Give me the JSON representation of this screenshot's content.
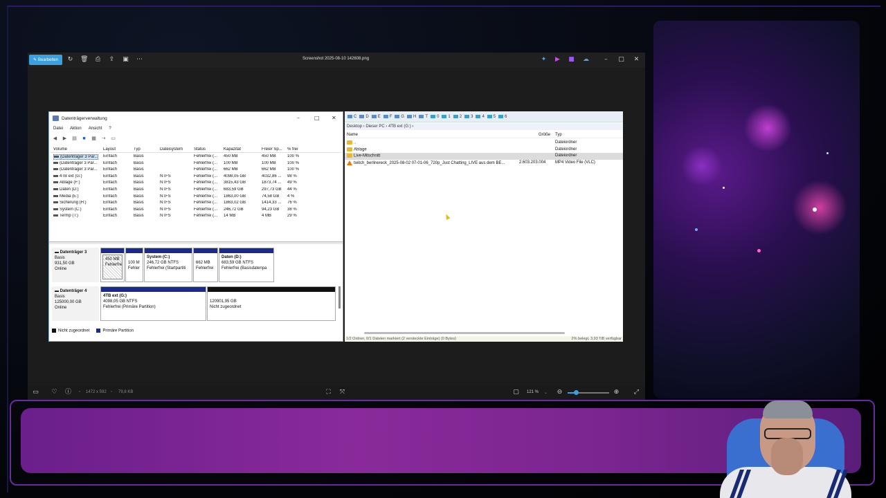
{
  "viewer": {
    "edit_label": "Bearbeiten",
    "title": "Screenshot 2025-08-10 142608.png",
    "dimensions": "1472 x 592",
    "filesize": "79,8 KB",
    "zoom": "121 %",
    "zoom_fraction": 0.2,
    "accent_color": "#3aa0e0"
  },
  "disk_mgmt": {
    "title": "Datenträgerverwaltung",
    "menu": [
      "Datei",
      "Aktion",
      "Ansicht",
      "?"
    ],
    "columns": [
      "Volume",
      "Layout",
      "Typ",
      "Dateisystem",
      "Status",
      "Kapazität",
      "Freier Sp...",
      "% frei"
    ],
    "rows": [
      [
        "(Datenträger 3 Par...",
        "Einfach",
        "Basis",
        "",
        "Fehlerfrei (...",
        "450 MB",
        "450 MB",
        "100 %"
      ],
      [
        "(Datenträger 3 Par...",
        "Einfach",
        "Basis",
        "",
        "Fehlerfrei (...",
        "100 MB",
        "100 MB",
        "100 %"
      ],
      [
        "(Datenträger 3 Par...",
        "Einfach",
        "Basis",
        "",
        "Fehlerfrei (...",
        "662 MB",
        "662 MB",
        "100 %"
      ],
      [
        "4TB ext (G:)",
        "Einfach",
        "Basis",
        "NTFS",
        "Fehlerfrei (...",
        "4098,05 GB",
        "4032,86 ...",
        "98 %"
      ],
      [
        "Ablage (F:)",
        "Einfach",
        "Basis",
        "NTFS",
        "Fehlerfrei (...",
        "3815,43 GB",
        "1873,74 ...",
        "49 %"
      ],
      [
        "Daten (D:)",
        "Einfach",
        "Basis",
        "NTFS",
        "Fehlerfrei (...",
        "683,59 GB",
        "297,73 GB",
        "44 %"
      ],
      [
        "Media (E:)",
        "Einfach",
        "Basis",
        "NTFS",
        "Fehlerfrei (...",
        "1863,00 GB",
        "74,58 GB",
        "4 %"
      ],
      [
        "Sicherung (H:)",
        "Einfach",
        "Basis",
        "NTFS",
        "Fehlerfrei (...",
        "1863,02 GB",
        "1414,33 ...",
        "76 %"
      ],
      [
        "System (C:)",
        "Einfach",
        "Basis",
        "NTFS",
        "Fehlerfrei (...",
        "246,72 GB",
        "94,23 GB",
        "38 %"
      ],
      [
        "Termp (T:)",
        "Einfach",
        "Basis",
        "NTFS",
        "Fehlerfrei (...",
        "14 MB",
        "4 MB",
        "29 %"
      ]
    ],
    "disk3": {
      "name": "Datenträger 3",
      "type": "Basis",
      "size": "931,50 GB",
      "state": "Online",
      "parts": [
        {
          "l1": "",
          "l2": "450 MB",
          "l3": "Fehlerfre"
        },
        {
          "l1": "",
          "l2": "100 M",
          "l3": "Fehler"
        },
        {
          "l1": "System (C:)",
          "l2": "246,72 GB NTFS",
          "l3": "Fehlerfrei (Startpartiti"
        },
        {
          "l1": "",
          "l2": "662 MB",
          "l3": "Fehlerfrei"
        },
        {
          "l1": "Daten (D:)",
          "l2": "683,59 GB NTFS",
          "l3": "Fehlerfrei (Basisdatenpa"
        }
      ]
    },
    "disk4": {
      "name": "Datenträger 4",
      "type": "Basis",
      "size": "125000,00 GB",
      "state": "Online",
      "parts": [
        {
          "l1": "4TB ext (G:)",
          "l2": "4098,05 GB NTFS",
          "l3": "Fehlerfrei (Primäre Partition)"
        },
        {
          "l1": "",
          "l2": "120901,95 GB",
          "l3": "Nicht zugeordnet"
        }
      ]
    },
    "legend": [
      "Nicht zugeordnet",
      "Primäre Partition"
    ]
  },
  "file_mgr": {
    "drives": [
      "C",
      "D",
      "E",
      "F",
      "G",
      "H",
      "T",
      "0",
      "1",
      "2",
      "3",
      "4",
      "5",
      "6"
    ],
    "path": "Desktop › Dieser PC › 4TB ext (G:) ›",
    "columns": [
      "Name",
      "Größe",
      "Typ"
    ],
    "rows": [
      {
        "name": "..",
        "size": "",
        "type": "Dateiordner",
        "icon": "folder-icon"
      },
      {
        "name": "Ablage",
        "size": "",
        "type": "Dateiordner",
        "icon": "folder-icon"
      },
      {
        "name": "Live-Mitschnitt",
        "size": "",
        "type": "Dateiordner",
        "icon": "folder-icon"
      },
      {
        "name": "twitch_berlinereck_2025-08-02 07-01-06_720p_Just Chatting_LIVE aus dem BE...",
        "size": "2.603.203.004",
        "type": "MP4 Video File (VLC)",
        "icon": "vlc-icon"
      }
    ],
    "status_left": "1/2 Ordner, 0/1 Dateien markiert (2 versteckte Einträge) (0 Bytes)",
    "status_right": "2% belegt, 3,93 TiB verfügbar"
  }
}
